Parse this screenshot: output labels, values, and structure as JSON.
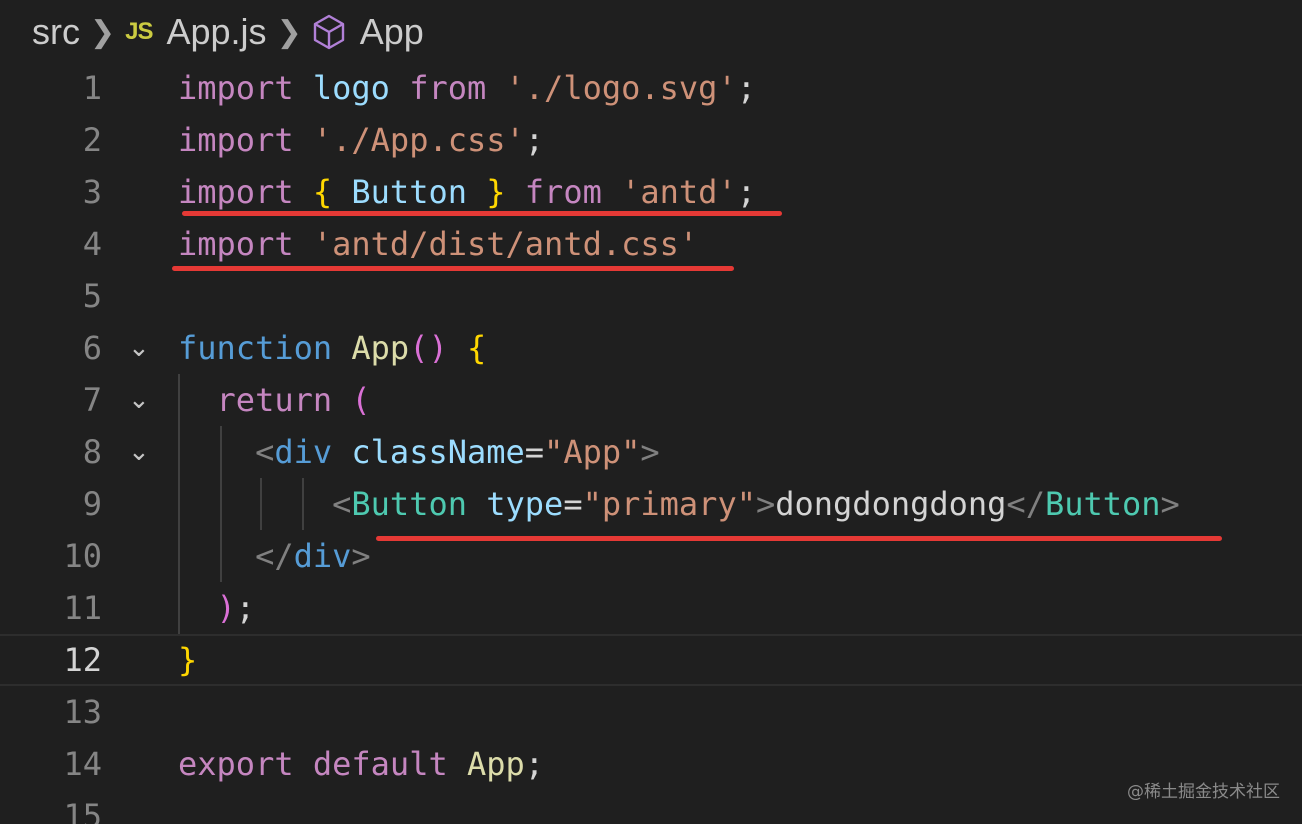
{
  "breadcrumb": {
    "folder": "src",
    "file_icon": "JS",
    "file": "App.js",
    "symbol_icon": "cube-icon",
    "symbol": "App"
  },
  "lines": [
    {
      "number": "1",
      "tokens": [
        {
          "text": "import",
          "role": "kw-purple"
        },
        {
          "text": " ",
          "role": "punc"
        },
        {
          "text": "logo",
          "role": "var"
        },
        {
          "text": " ",
          "role": "punc"
        },
        {
          "text": "from",
          "role": "kw-purple"
        },
        {
          "text": " ",
          "role": "punc"
        },
        {
          "text": "'./logo.svg'",
          "role": "str"
        },
        {
          "text": ";",
          "role": "punc"
        }
      ]
    },
    {
      "number": "2",
      "tokens": [
        {
          "text": "import",
          "role": "kw-purple"
        },
        {
          "text": " ",
          "role": "punc"
        },
        {
          "text": "'./App.css'",
          "role": "str"
        },
        {
          "text": ";",
          "role": "punc"
        }
      ]
    },
    {
      "number": "3",
      "tokens": [
        {
          "text": "import",
          "role": "kw-purple"
        },
        {
          "text": " ",
          "role": "punc"
        },
        {
          "text": "{",
          "role": "brace-y"
        },
        {
          "text": " ",
          "role": "punc"
        },
        {
          "text": "Button",
          "role": "var"
        },
        {
          "text": " ",
          "role": "punc"
        },
        {
          "text": "}",
          "role": "brace-y"
        },
        {
          "text": " ",
          "role": "punc"
        },
        {
          "text": "from",
          "role": "kw-purple"
        },
        {
          "text": " ",
          "role": "punc"
        },
        {
          "text": "'antd'",
          "role": "str"
        },
        {
          "text": ";",
          "role": "punc"
        }
      ]
    },
    {
      "number": "4",
      "tokens": [
        {
          "text": "import",
          "role": "kw-purple"
        },
        {
          "text": " ",
          "role": "punc"
        },
        {
          "text": "'antd/dist/antd.css'",
          "role": "str"
        }
      ]
    },
    {
      "number": "5",
      "tokens": []
    },
    {
      "number": "6",
      "fold": "⌄",
      "tokens": [
        {
          "text": "function",
          "role": "kw-blue"
        },
        {
          "text": " ",
          "role": "punc"
        },
        {
          "text": "App",
          "role": "fn"
        },
        {
          "text": "()",
          "role": "brace-p"
        },
        {
          "text": " ",
          "role": "punc"
        },
        {
          "text": "{",
          "role": "brace-y"
        }
      ]
    },
    {
      "number": "7",
      "fold": "⌄",
      "tokens": [
        {
          "text": "  ",
          "role": "punc"
        },
        {
          "text": "return",
          "role": "kw-purple"
        },
        {
          "text": " ",
          "role": "punc"
        },
        {
          "text": "(",
          "role": "brace-p"
        }
      ]
    },
    {
      "number": "8",
      "fold": "⌄",
      "tokens": [
        {
          "text": "    ",
          "role": "punc"
        },
        {
          "text": "<",
          "role": "tag-ang"
        },
        {
          "text": "div",
          "role": "tag"
        },
        {
          "text": " ",
          "role": "punc"
        },
        {
          "text": "className",
          "role": "attr"
        },
        {
          "text": "=",
          "role": "punc"
        },
        {
          "text": "\"App\"",
          "role": "str"
        },
        {
          "text": ">",
          "role": "tag-ang"
        }
      ]
    },
    {
      "number": "9",
      "tokens": [
        {
          "text": "        ",
          "role": "punc"
        },
        {
          "text": "<",
          "role": "tag-ang"
        },
        {
          "text": "Button",
          "role": "comp"
        },
        {
          "text": " ",
          "role": "punc"
        },
        {
          "text": "type",
          "role": "attr"
        },
        {
          "text": "=",
          "role": "punc"
        },
        {
          "text": "\"primary\"",
          "role": "str"
        },
        {
          "text": ">",
          "role": "tag-ang"
        },
        {
          "text": "dongdongdong",
          "role": "text"
        },
        {
          "text": "</",
          "role": "tag-ang"
        },
        {
          "text": "Button",
          "role": "comp"
        },
        {
          "text": ">",
          "role": "tag-ang"
        }
      ]
    },
    {
      "number": "10",
      "tokens": [
        {
          "text": "    ",
          "role": "punc"
        },
        {
          "text": "</",
          "role": "tag-ang"
        },
        {
          "text": "div",
          "role": "tag"
        },
        {
          "text": ">",
          "role": "tag-ang"
        }
      ]
    },
    {
      "number": "11",
      "tokens": [
        {
          "text": "  ",
          "role": "punc"
        },
        {
          "text": ")",
          "role": "brace-p"
        },
        {
          "text": ";",
          "role": "punc"
        }
      ]
    },
    {
      "number": "12",
      "current": true,
      "tokens": [
        {
          "text": "}",
          "role": "brace-y"
        }
      ]
    },
    {
      "number": "13",
      "tokens": []
    },
    {
      "number": "14",
      "tokens": [
        {
          "text": "export",
          "role": "kw-purple"
        },
        {
          "text": " ",
          "role": "punc"
        },
        {
          "text": "default",
          "role": "kw-purple"
        },
        {
          "text": " ",
          "role": "punc"
        },
        {
          "text": "App",
          "role": "fn"
        },
        {
          "text": ";",
          "role": "punc"
        }
      ]
    },
    {
      "number": "15",
      "tokens": []
    }
  ],
  "annotation_color": "#e53935",
  "watermark": "@稀土掘金技术社区"
}
